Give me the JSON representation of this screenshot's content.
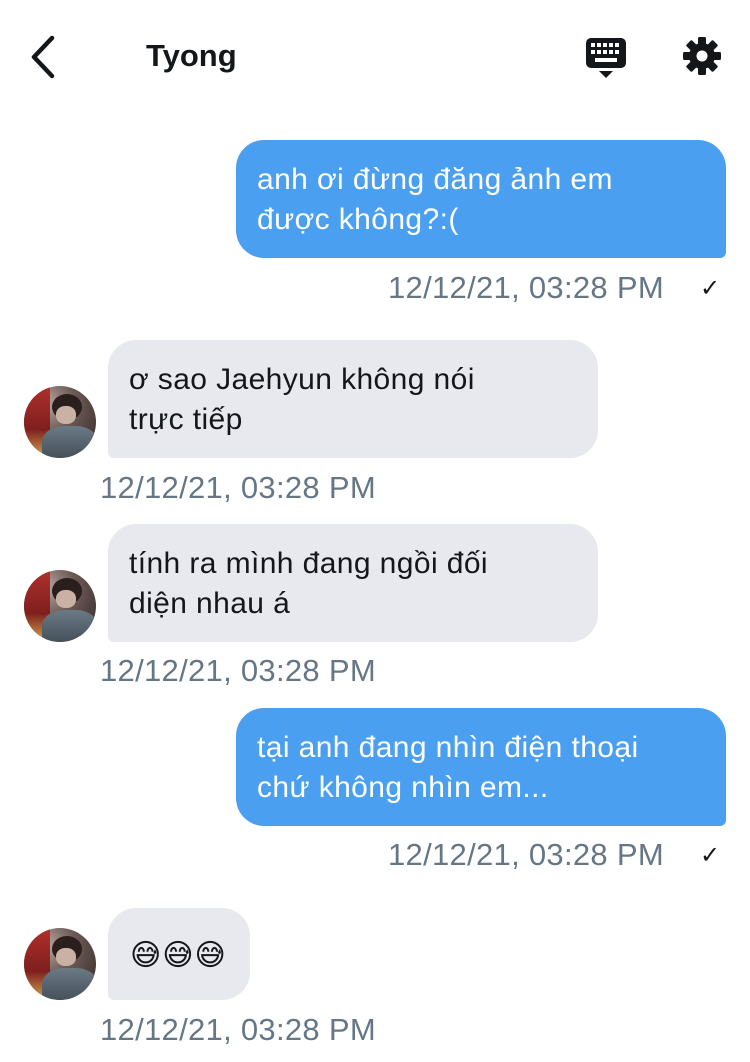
{
  "header": {
    "title": "Tyong",
    "back_icon": "chevron-left-icon",
    "keyboard_icon": "keyboard-icon",
    "settings_icon": "gear-icon"
  },
  "colors": {
    "outgoing_bubble": "#4b9ff0",
    "incoming_bubble": "#e7e9ee",
    "timestamp": "#657786"
  },
  "messages": [
    {
      "direction": "outgoing",
      "lines": [
        "anh ơi đừng đăng ảnh em",
        "được không?:("
      ],
      "time": "12/12/21, 03:28 PM",
      "read_mark": "✓"
    },
    {
      "direction": "incoming",
      "lines": [
        "ơ sao Jaehyun không nói",
        "trực tiếp"
      ],
      "time": "12/12/21, 03:28 PM"
    },
    {
      "direction": "incoming",
      "lines": [
        "tính ra mình đang ngồi đối",
        "diện nhau á"
      ],
      "time": "12/12/21, 03:28 PM"
    },
    {
      "direction": "outgoing",
      "lines": [
        "tại anh đang nhìn điện thoại",
        "chứ không nhìn em..."
      ],
      "time": "12/12/21, 03:28 PM",
      "read_mark": "✓"
    },
    {
      "direction": "incoming",
      "lines": [
        "😅😅😅"
      ],
      "time": "12/12/21, 03:28 PM"
    }
  ]
}
